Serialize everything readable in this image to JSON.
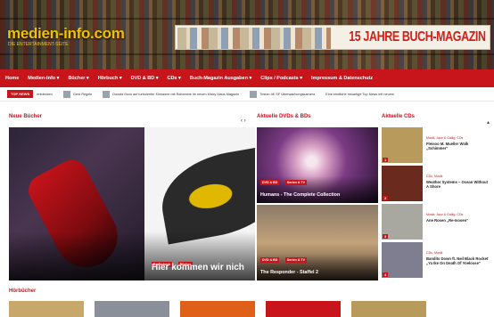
{
  "header": {
    "logo": "medien-info.com",
    "logo_sub": "DIE ENTERTAINMENT-SEITE",
    "banner_text": "15 JAHRE BUCH-MAGAZIN"
  },
  "nav": {
    "items": [
      "Home",
      "Medien-Info ▾",
      "Bücher ▾",
      "Hörbuch ▾",
      "DVD & BD ▾",
      "CDs ▾",
      "Buch-Magazin Ausgaben ▾",
      "Clips / Podcasts ▾",
      "Impressum & Datenschutz"
    ]
  },
  "ticker": {
    "badge": "TOP NEWS",
    "items": [
      "Gerd Regeln",
      "Donald Duck auf turbulenter Klimaone mit Rabomine im neuen Micky Maus Magazin",
      "Tristan 4K SF Überwachungskamera",
      "Eine kindliche neuartige Top News mit neuem"
    ],
    "trailing": "entdecken"
  },
  "sections": {
    "new_books": "Neue Bücher",
    "dvds": "Aktuelle DVDs & BDs",
    "cds": "Aktuelle CDs",
    "audiobooks": "Hörbücher"
  },
  "hero": {
    "tags": [
      "Buchcheck",
      "Bücher"
    ],
    "title": "Hier kommen wir nich"
  },
  "dvds": [
    {
      "tags": [
        "DVD & BD",
        "Serien & TV"
      ],
      "title": "Humans - The Complete Collection"
    },
    {
      "tags": [
        "DVD & BD",
        "Serien & TV"
      ],
      "title": "The Responder - Staffel 2"
    }
  ],
  "cds": [
    {
      "num": "1",
      "meta": "Musik, Jazz & Gallig, CDs",
      "title": "Fleisoo M. Mueller Wolk „Schimmer“",
      "color": "#b79a5c"
    },
    {
      "num": "2",
      "meta": "CDs, Musik",
      "title": "Weather Systems – Ocean Without A Shore",
      "color": "#6a2a1e"
    },
    {
      "num": "3",
      "meta": "Musik, Jazz & Gallig, CDs",
      "title": "Ane Rosen „Re-Isosen“",
      "color": "#a8a8a0"
    },
    {
      "num": "4",
      "meta": "CDs, Musik",
      "title": "Bandits Down ft. Neil Black Rocket „Ya Ike On Death Of Yoeloose“",
      "color": "#7e7e90"
    }
  ],
  "audiobook_thumbs": [
    "#c8a86a",
    "#8a8f9a",
    "#e0601a",
    "#c8141b",
    "#b89a5a"
  ]
}
